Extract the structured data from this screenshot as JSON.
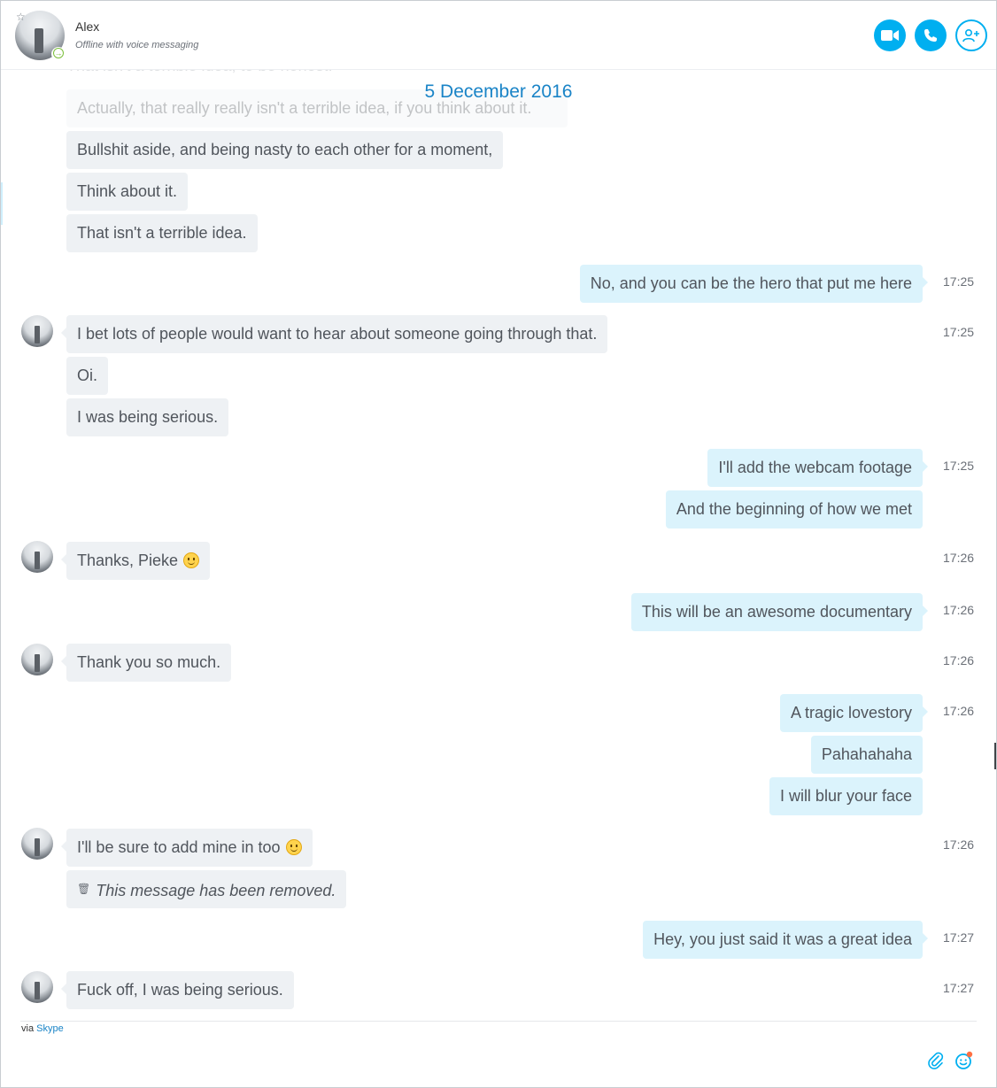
{
  "header": {
    "contact_name": "Alex",
    "contact_status": "Offline with voice messaging",
    "video_call_icon": "video-camera-icon",
    "audio_call_icon": "phone-icon",
    "add_people_icon": "add-person-icon"
  },
  "faded_messages": [
    "That isn't a terrible idea, to be honest.",
    "Actually, that really really isn't a terrible idea, if you think about it."
  ],
  "date_divider": "5 December 2016",
  "messages": [
    {
      "id": "m1",
      "from": "them",
      "text": "Bullshit aside, and being nasty to each other for a moment,",
      "time": ""
    },
    {
      "id": "m2",
      "from": "them",
      "text": "Think about it.",
      "time": ""
    },
    {
      "id": "m3",
      "from": "them",
      "text": "That isn't a terrible idea.",
      "time": ""
    },
    {
      "id": "m4",
      "from": "me",
      "text": "No, and you can be the hero that put me here",
      "time": "17:25"
    },
    {
      "id": "m5",
      "from": "them",
      "text": "I bet lots of people would want to hear about someone going through that.",
      "time": "17:25"
    },
    {
      "id": "m6",
      "from": "them",
      "text": "Oi.",
      "time": ""
    },
    {
      "id": "m7",
      "from": "them",
      "text": "I was being serious.",
      "time": ""
    },
    {
      "id": "m8",
      "from": "me",
      "text": "I'll add the webcam footage",
      "time": "17:25"
    },
    {
      "id": "m9",
      "from": "me",
      "text": "And the beginning of how we met",
      "time": ""
    },
    {
      "id": "m10",
      "from": "them",
      "text": "Thanks, Pieke",
      "emoji": "smile-emoji",
      "time": "17:26"
    },
    {
      "id": "m11",
      "from": "me",
      "text": "This will be an awesome documentary",
      "time": "17:26"
    },
    {
      "id": "m12",
      "from": "them",
      "text": "Thank you so much.",
      "time": "17:26"
    },
    {
      "id": "m13",
      "from": "me",
      "text": "A tragic lovestory",
      "time": "17:26"
    },
    {
      "id": "m14",
      "from": "me",
      "text": "Pahahahaha",
      "time": ""
    },
    {
      "id": "m15",
      "from": "me",
      "text": "I will blur your face",
      "time": ""
    },
    {
      "id": "m16",
      "from": "them",
      "text": "I'll be sure to add mine in too",
      "emoji": "smile-emoji",
      "time": "17:26"
    },
    {
      "id": "m17",
      "from": "them",
      "text": "This message has been removed.",
      "removed": true,
      "time": ""
    },
    {
      "id": "m18",
      "from": "me",
      "text": "Hey, you just said it was a great idea",
      "time": "17:27"
    },
    {
      "id": "m19",
      "from": "them",
      "text": "Fuck off, I was being serious.",
      "time": "17:27"
    }
  ],
  "footer": {
    "via_prefix": "via",
    "via_link": "Skype",
    "attach_icon": "paperclip-icon",
    "emoticon_icon": "emoticon-icon"
  },
  "colors": {
    "accent": "#00aff0",
    "date": "#1a84c7",
    "incoming_bubble": "#eef1f4",
    "outgoing_bubble": "#dbf3fc"
  }
}
